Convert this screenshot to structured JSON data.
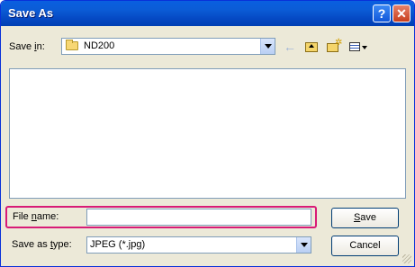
{
  "window": {
    "title": "Save As"
  },
  "titlebar": {
    "help_glyph": "?",
    "close_glyph": "✕"
  },
  "save_in": {
    "label_prefix": "Save ",
    "label_accel": "i",
    "label_suffix": "n:",
    "folder": "ND200"
  },
  "toolbar": {
    "icons": [
      "back-arrow-icon",
      "up-folder-icon",
      "new-folder-icon",
      "views-menu-icon"
    ]
  },
  "file_name": {
    "label_prefix": "File ",
    "label_accel": "n",
    "label_suffix": "ame:",
    "value": ""
  },
  "save_as_type": {
    "label_prefix": "Save as ",
    "label_accel": "t",
    "label_suffix": "ype:",
    "value": "JPEG (*.jpg)"
  },
  "buttons": {
    "save_accel": "S",
    "save_rest": "ave",
    "cancel": "Cancel"
  },
  "colors": {
    "highlight": "#d81b77",
    "titlebar": "#0b5cd6"
  }
}
